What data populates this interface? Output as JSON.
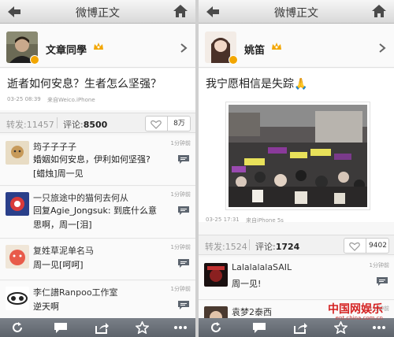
{
  "left": {
    "nav_title": "微博正文",
    "user_name": "文章同學",
    "post_text": "逝者如何安息？生者怎么坚强？",
    "post_time": "03-25 08:39",
    "post_source": "来自Weico.iPhone",
    "reposts": "转发:11457",
    "comments_label": "评论:",
    "comments_count": "8500",
    "likes": "8万",
    "comments": [
      {
        "name": "筠子子子子",
        "line1": "婚姻如何安息，伊利如何坚强?",
        "line2": "[蜡烛]周一见",
        "time": "1分钟前"
      },
      {
        "name": "一只旅途中的猫何去何从",
        "line1": "回复Agie_Jongsuk: 到底什么意",
        "line2": "思啊，周一[泪]",
        "time": "1分钟前"
      },
      {
        "name": "复姓草泥单名马",
        "line1": "周一见[呵呵]",
        "line2": "",
        "time": "1分钟前"
      },
      {
        "name": "李仁譜Ranpoo工作室",
        "line1": "逆天啊",
        "line2": "",
        "time": "1分钟前"
      }
    ]
  },
  "right": {
    "nav_title": "微博正文",
    "user_name": "姚笛",
    "post_text": "我宁愿相信是失踪🙏",
    "post_time": "03-25 17:31",
    "post_source": "来自iPhone 5s",
    "reposts": "转发:1524",
    "comments_label": "评论:",
    "comments_count": "1724",
    "likes": "9402",
    "comments": [
      {
        "name": "LalalalalaSAIL",
        "line1": "周一见!",
        "line2": "",
        "time": "1分钟前"
      },
      {
        "name": "袁梦2泰西",
        "line1": "",
        "line2": "",
        "time": "1分钟前"
      }
    ]
  },
  "watermark": {
    "logo": "中国网娱乐",
    "url": "ent.china.com.cn"
  },
  "icons": [
    "back-arrow-icon",
    "home-icon",
    "crown-icon",
    "chevron-right-icon",
    "heart-icon",
    "comment-bubble-icon",
    "refresh-icon",
    "share-icon",
    "star-icon",
    "more-icon"
  ],
  "colors": {
    "vip": "#f2a600",
    "tabbar": "#666c74",
    "watermark": "#d42222"
  }
}
